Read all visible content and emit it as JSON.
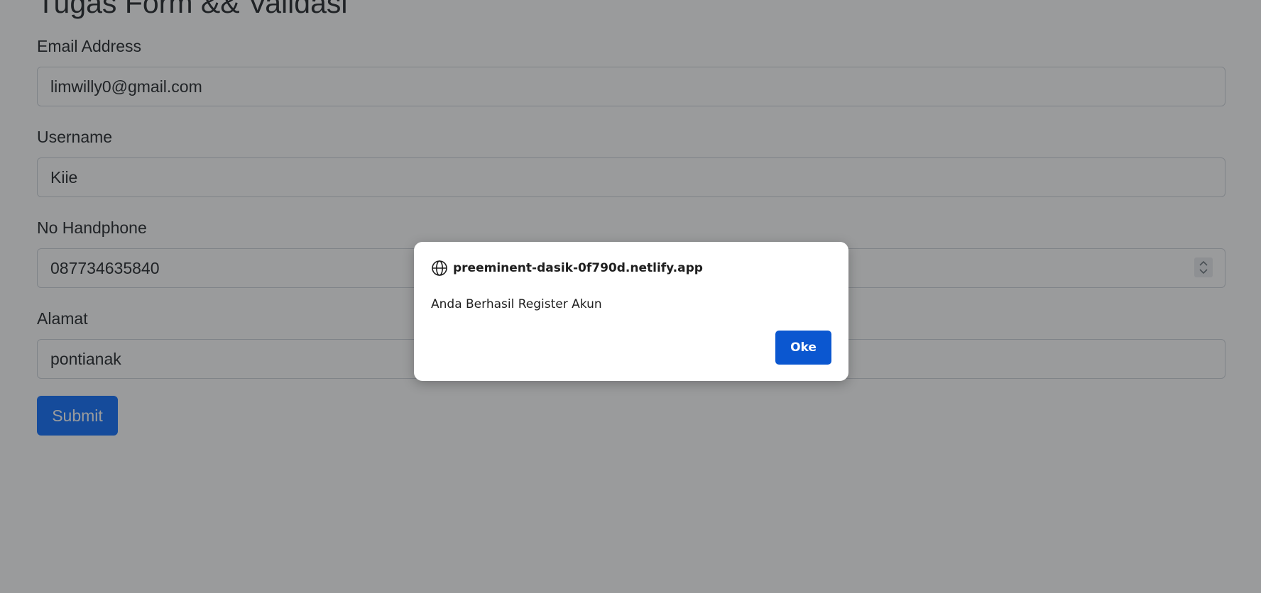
{
  "form": {
    "title": "Tugas Form && Validasi",
    "fields": [
      {
        "label": "Email Address",
        "value": "limwilly0@gmail.com"
      },
      {
        "label": "Username",
        "value": "Kiie"
      },
      {
        "label": "No Handphone",
        "value": "087734635840"
      },
      {
        "label": "Alamat",
        "value": "pontianak"
      }
    ],
    "submit_label": "Submit"
  },
  "dialog": {
    "origin": "preeminent-dasik-0f790d.netlify.app",
    "message": "Anda Berhasil Register Akun",
    "ok_label": "Oke",
    "icon": "globe-icon"
  },
  "colors": {
    "primary_button": "#0d6efd",
    "dialog_button": "#0b57d0",
    "overlay": "rgba(32, 33, 36, 0.45)"
  }
}
